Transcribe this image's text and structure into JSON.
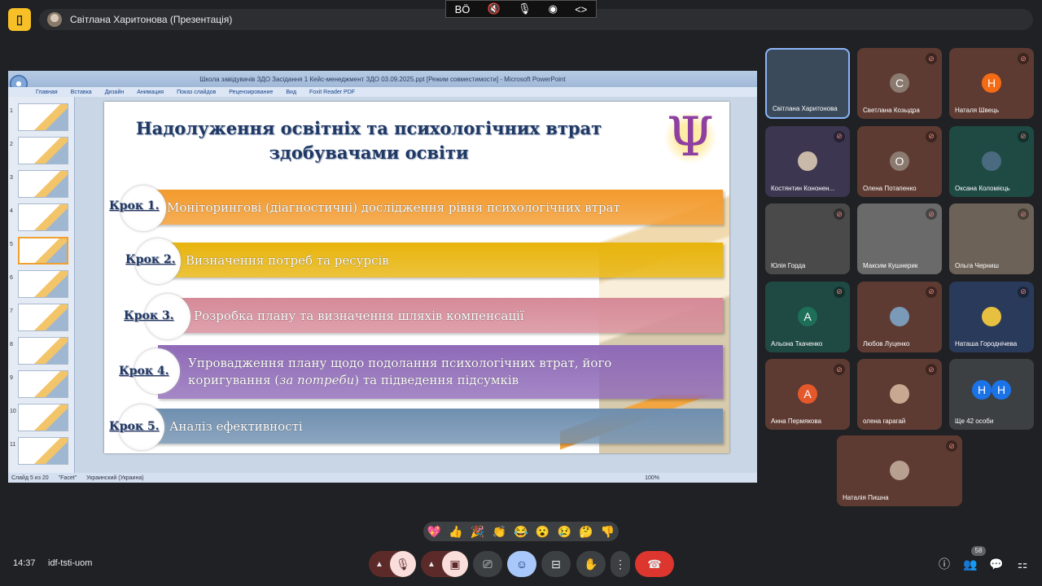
{
  "top_bar": {
    "presenter_label": "Світлана Харитонова (Презентація)"
  },
  "share_toolbar": {
    "items": [
      "BÖ",
      "🔇",
      "🎙",
      "◉",
      "<>"
    ]
  },
  "ppt": {
    "window_title": "Школа завідувачів ЗДО Засідання 1 Кейс-менеджмент ЗДО 03.09.2025.ppt [Режим совместимости] - Microsoft PowerPoint",
    "ribbon_tabs": [
      "Главная",
      "Вставка",
      "Дизайн",
      "Анимация",
      "Показ слайдов",
      "Рецензирование",
      "Вид",
      "Foxit Reader PDF"
    ],
    "thumb_numbers": [
      "1",
      "2",
      "3",
      "4",
      "5",
      "6",
      "7",
      "8",
      "9",
      "10",
      "11"
    ],
    "status": {
      "slide": "Слайд 5 из 20",
      "theme": "\"Facet\"",
      "language": "Украинский (Украина)",
      "zoom": "100%"
    }
  },
  "slide": {
    "title_line1": "Надолуження освітніх та психологічних втрат",
    "title_line2": "здобувачами освіти",
    "logo": "Ψ",
    "steps": [
      {
        "label": "Крок 1.",
        "text": "Моніторингові (діагностичні) дослідження рівня психологічних втрат",
        "color": "#f39a2c"
      },
      {
        "label": "Крок 2.",
        "text": "Визначення потреб та ресурсів",
        "color": "#e8b40c"
      },
      {
        "label": "Крок 3.",
        "text": "Розробка плану та визначення шляхів компенсації",
        "color": "#d68a98"
      },
      {
        "label": "Крок 4.",
        "text_a": "Упровадження плану щодо подолання психологічних втрат,  його",
        "text_b": "коригування (",
        "text_em": "за потреби",
        "text_c": ") та підведення підсумків",
        "color": "#8f6ab8"
      },
      {
        "label": "Крок 5.",
        "text": "Аналіз ефективності",
        "color": "#6f8fb0"
      }
    ]
  },
  "participants": [
    {
      "name": "Світлана Харитонова",
      "avatar": "",
      "bg": "#3a4a5a",
      "muted": false
    },
    {
      "name": "Светлана Козыдра",
      "avatar": "C",
      "bg": "#5e3b32",
      "avatar_bg": "#8a7a70",
      "muted": true
    },
    {
      "name": "Наталя Швець",
      "avatar": "Н",
      "bg": "#5e3b32",
      "avatar_bg": "#f56b14",
      "muted": true
    },
    {
      "name": "Костянтин Кононен...",
      "avatar": "",
      "bg": "#3d3650",
      "avatar_bg": "#c9b9a8",
      "muted": true
    },
    {
      "name": "Олена Потапенко",
      "avatar": "О",
      "bg": "#5e3b32",
      "avatar_bg": "#8a7a70",
      "muted": true
    },
    {
      "name": "Оксана Коломієць",
      "avatar": "",
      "bg": "#1f4a44",
      "avatar_bg": "#4a6a80",
      "muted": true
    },
    {
      "name": "Юлія Горда",
      "avatar": "",
      "bg": "#4a4a4a",
      "muted": true
    },
    {
      "name": "Максим Кушнерик",
      "avatar": "",
      "bg": "#6a6a6a",
      "muted": true
    },
    {
      "name": "Ольга Черниш",
      "avatar": "",
      "bg": "#6d6258",
      "muted": true
    },
    {
      "name": "Альона Ткаченко",
      "avatar": "А",
      "bg": "#1f4a44",
      "avatar_bg": "#1e6f57",
      "muted": true
    },
    {
      "name": "Любов Луценко",
      "avatar": "",
      "bg": "#5e3b32",
      "avatar_bg": "#7a9ab8",
      "muted": true
    },
    {
      "name": "Наташа Городнічева",
      "avatar": "",
      "bg": "#2a3a5a",
      "avatar_bg": "#e8c040",
      "muted": true
    },
    {
      "name": "Анна Пермякова",
      "avatar": "А",
      "bg": "#5e3b32",
      "avatar_bg": "#e5582b",
      "muted": true
    },
    {
      "name": "олена гарагай",
      "avatar": "",
      "bg": "#5e3b32",
      "avatar_bg": "#c8a890",
      "muted": true
    },
    {
      "name": "Ще 42 особи",
      "avatar": "",
      "bg": "#3c4043",
      "muted": false
    },
    {
      "name": "Наталія Пишна",
      "avatar": "",
      "bg": "#5e3b32",
      "avatar_bg": "#b8a090",
      "muted": true
    }
  ],
  "more_avatars": [
    "Н",
    "Н"
  ],
  "reactions": [
    "💖",
    "👍",
    "🎉",
    "👏",
    "😂",
    "😮",
    "😢",
    "🤔",
    "👎"
  ],
  "bottom": {
    "clock": "14:37",
    "meeting_code": "idf-tsti-uom",
    "participants_count": "58"
  }
}
